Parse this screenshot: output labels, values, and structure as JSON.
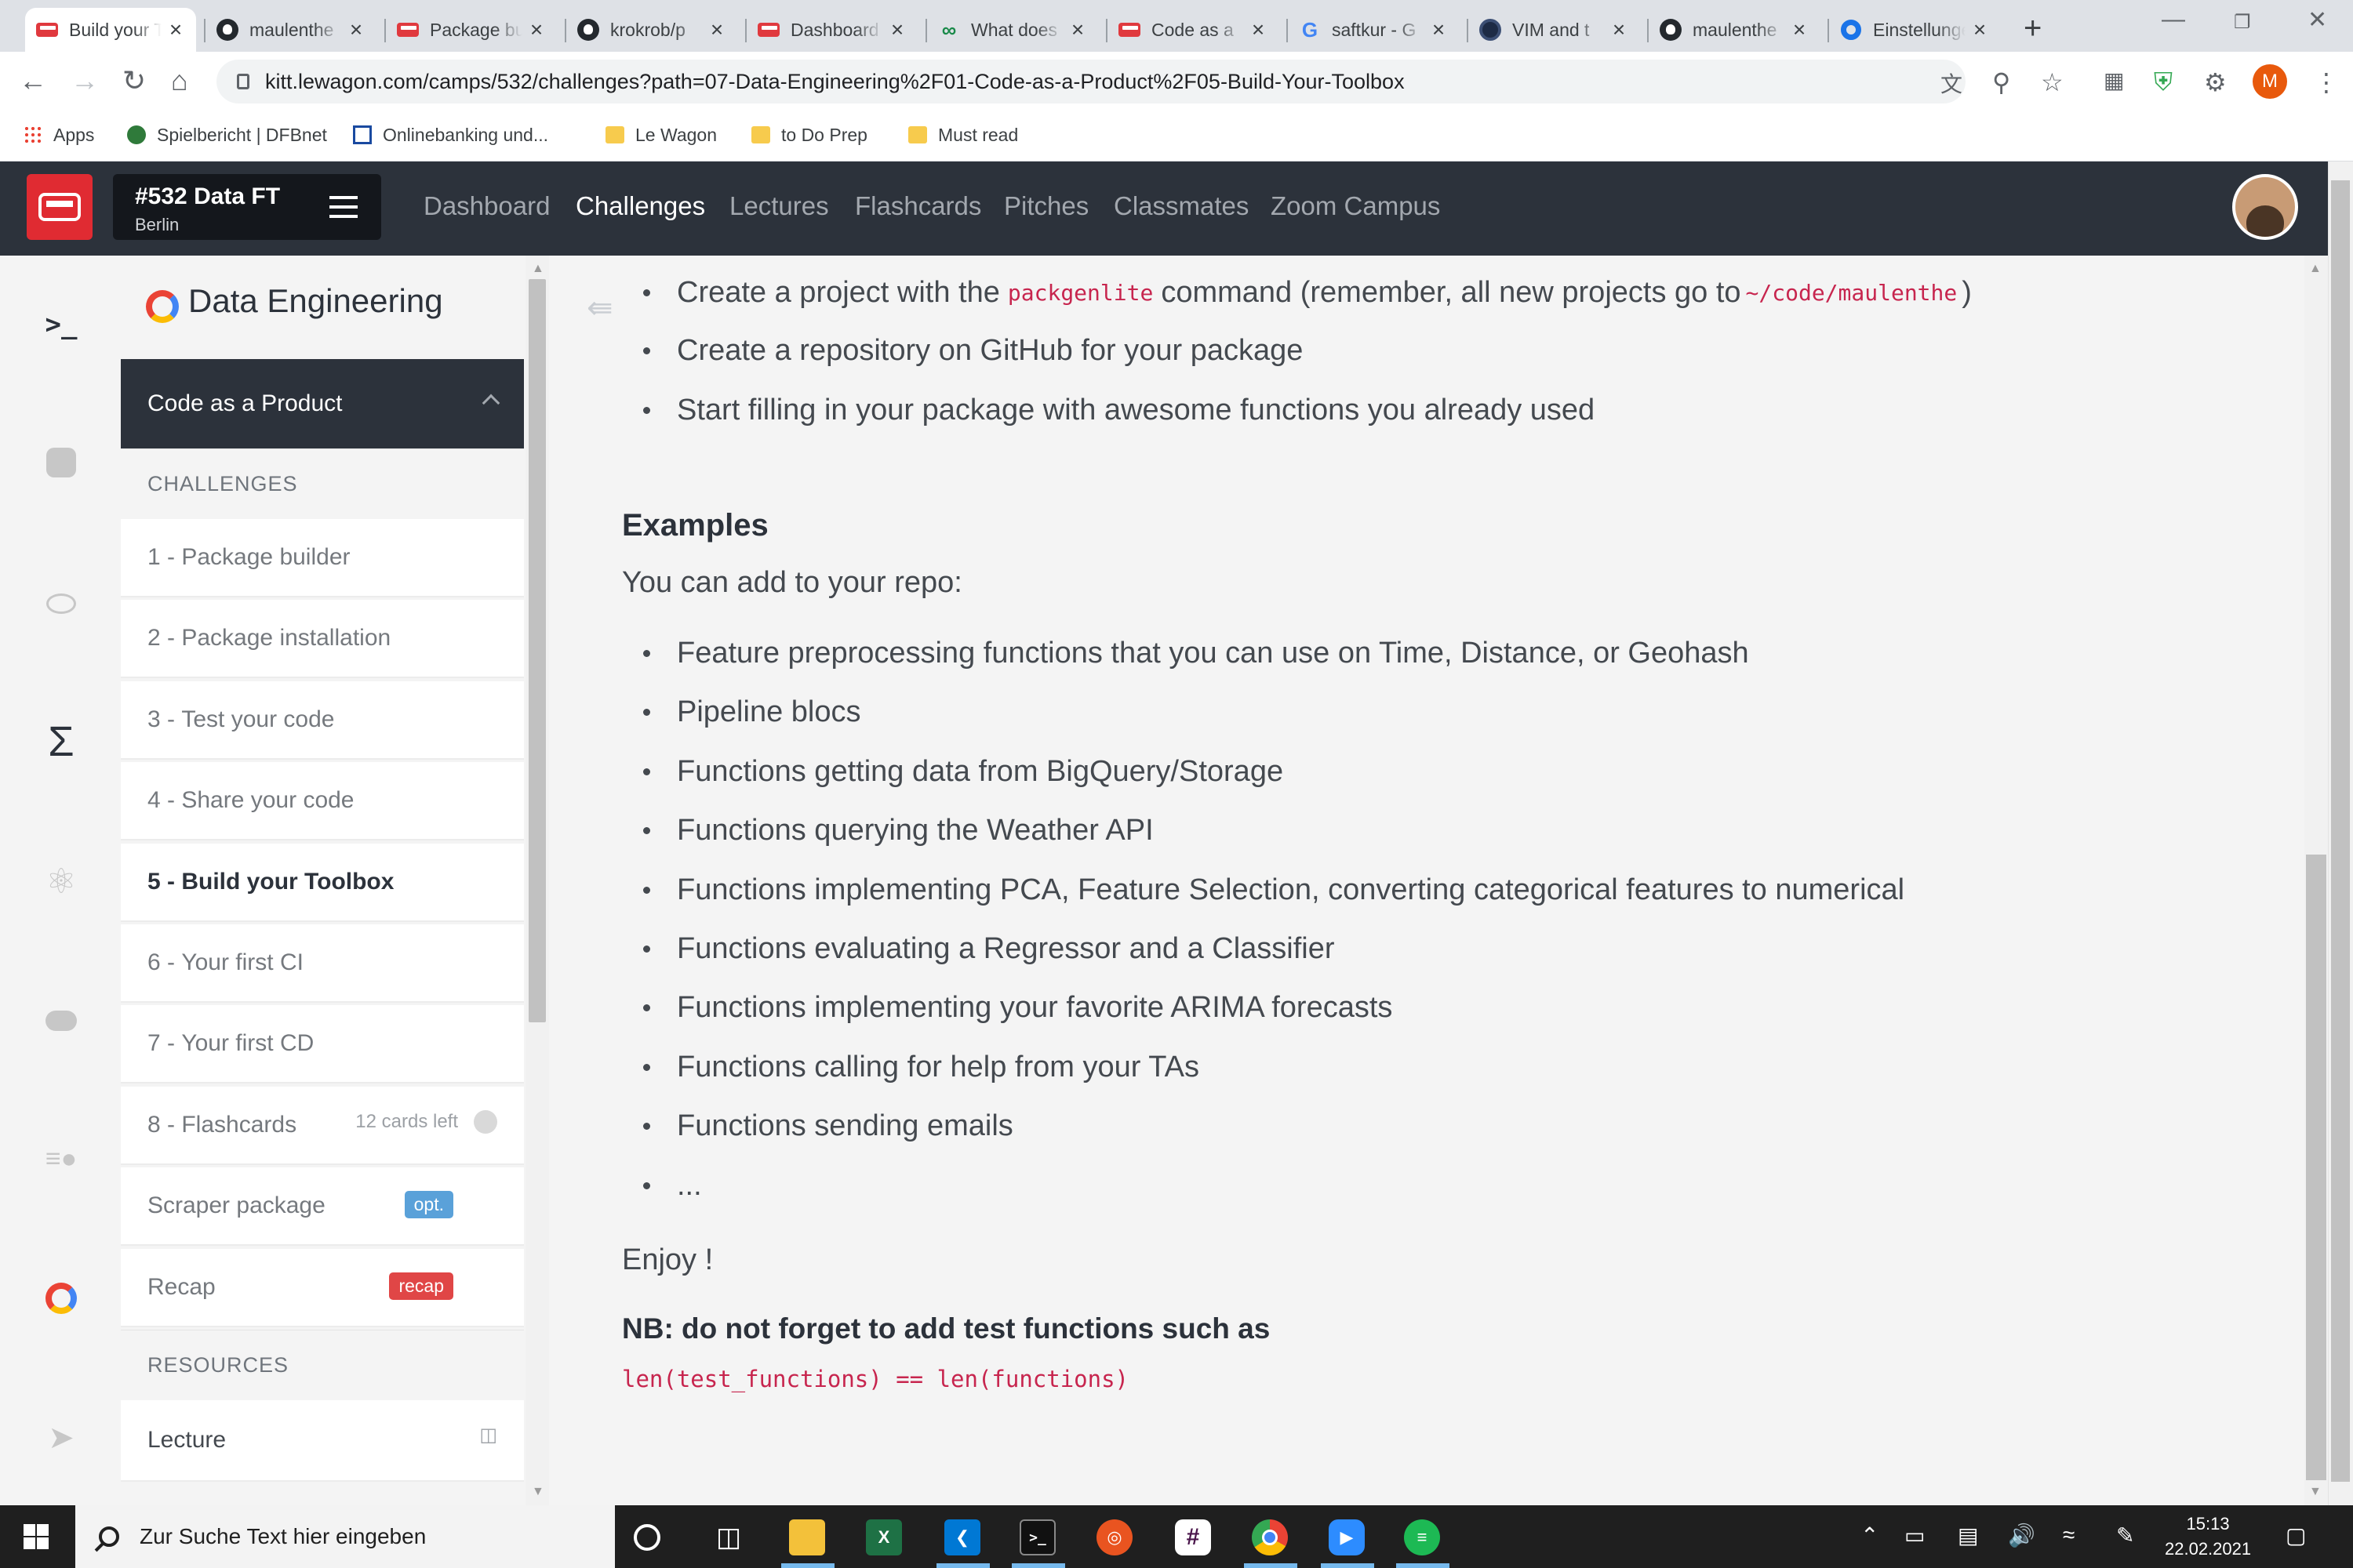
{
  "browser": {
    "tabs": [
      {
        "title": "Build your Toolbox",
        "icon": "lewagon-icon"
      },
      {
        "title": "maulenthe",
        "icon": "github-icon"
      },
      {
        "title": "Package builder",
        "icon": "lewagon-icon"
      },
      {
        "title": "krokrob/p",
        "icon": "github-icon"
      },
      {
        "title": "Dashboard",
        "icon": "lewagon-icon"
      },
      {
        "title": "What does",
        "icon": "link-icon"
      },
      {
        "title": "Code as a",
        "icon": "lewagon-icon"
      },
      {
        "title": "saftkur - G",
        "icon": "google-icon"
      },
      {
        "title": "VIM and t",
        "icon": "vim-icon"
      },
      {
        "title": "maulenthe",
        "icon": "github-icon"
      },
      {
        "title": "Einstellungen",
        "icon": "settings-icon"
      }
    ],
    "url": "kitt.lewagon.com/camps/532/challenges?path=07-Data-Engineering%2F01-Code-as-a-Product%2F05-Build-Your-Toolbox",
    "profile_initial": "M",
    "bookmarks": [
      {
        "label": "Apps",
        "icon": "apps-grid-icon"
      },
      {
        "label": "Spielbericht | DFBnet",
        "icon": "dfbnet-icon"
      },
      {
        "label": "Onlinebanking und...",
        "icon": "bank-icon"
      },
      {
        "label": "Le Wagon",
        "icon": "folder-icon"
      },
      {
        "label": "to Do Prep",
        "icon": "folder-icon"
      },
      {
        "label": "Must read",
        "icon": "folder-icon"
      }
    ]
  },
  "kitt": {
    "batch_title": "#532 Data FT",
    "batch_city": "Berlin",
    "nav": [
      "Dashboard",
      "Challenges",
      "Lectures",
      "Flashcards",
      "Pitches",
      "Classmates",
      "Zoom Campus"
    ],
    "active_nav": "Challenges"
  },
  "sidebar": {
    "module_title": "Data Engineering",
    "section_title": "Code as a Product",
    "challenges_header": "CHALLENGES",
    "resources_header": "RESOURCES",
    "items": [
      {
        "num": "1 - ",
        "label": "Package builder"
      },
      {
        "num": "2 - ",
        "label": "Package installation"
      },
      {
        "num": "3 - ",
        "label": "Test your code"
      },
      {
        "num": "4 - ",
        "label": "Share your code"
      },
      {
        "num": "5 - ",
        "label": "Build your Toolbox"
      },
      {
        "num": "6 - ",
        "label": "Your first CI"
      },
      {
        "num": "7 - ",
        "label": "Your first CD"
      },
      {
        "num": "8 - ",
        "label": "Flashcards",
        "extra": "12 cards left"
      },
      {
        "num": "",
        "label": "Scraper package",
        "badge": "opt."
      },
      {
        "num": "",
        "label": "Recap",
        "badge": "recap"
      }
    ],
    "resources": [
      {
        "label": "Lecture"
      }
    ],
    "colors": {
      "opt_badge": "#5aa1d9",
      "recap_badge": "#e04646",
      "header_bg": "#2c323b"
    }
  },
  "content": {
    "bullets_top": [
      {
        "pre": "Create a project with the ",
        "code": "packgenlite",
        "mid": " command (remember, all new projects go to ",
        "code2": "~/code/maulenthe",
        "post": ")"
      },
      {
        "pre": "Create a repository on GitHub for your package"
      },
      {
        "pre": "Start filling in your package with awesome functions you already used"
      }
    ],
    "examples_heading": "Examples",
    "examples_intro": "You can add to your repo:",
    "examples": [
      "Feature preprocessing functions that you can use on Time, Distance, or Geohash",
      "Pipeline blocs",
      "Functions getting data from BigQuery/Storage",
      "Functions querying the Weather API",
      "Functions implementing PCA, Feature Selection, converting categorical features to numerical",
      "Functions evaluating a Regressor and a Classifier",
      "Functions implementing your favorite ARIMA forecasts",
      "Functions calling for help from your TAs",
      "Functions sending emails",
      "..."
    ],
    "enjoy": "Enjoy !",
    "nb_heading": "NB: do not forget to add test functions such as",
    "nb_code": "len(test_functions) == len(functions)"
  },
  "taskbar": {
    "search_placeholder": "Zur Suche Text hier eingeben",
    "time": "15:13",
    "date": "22.02.2021"
  }
}
